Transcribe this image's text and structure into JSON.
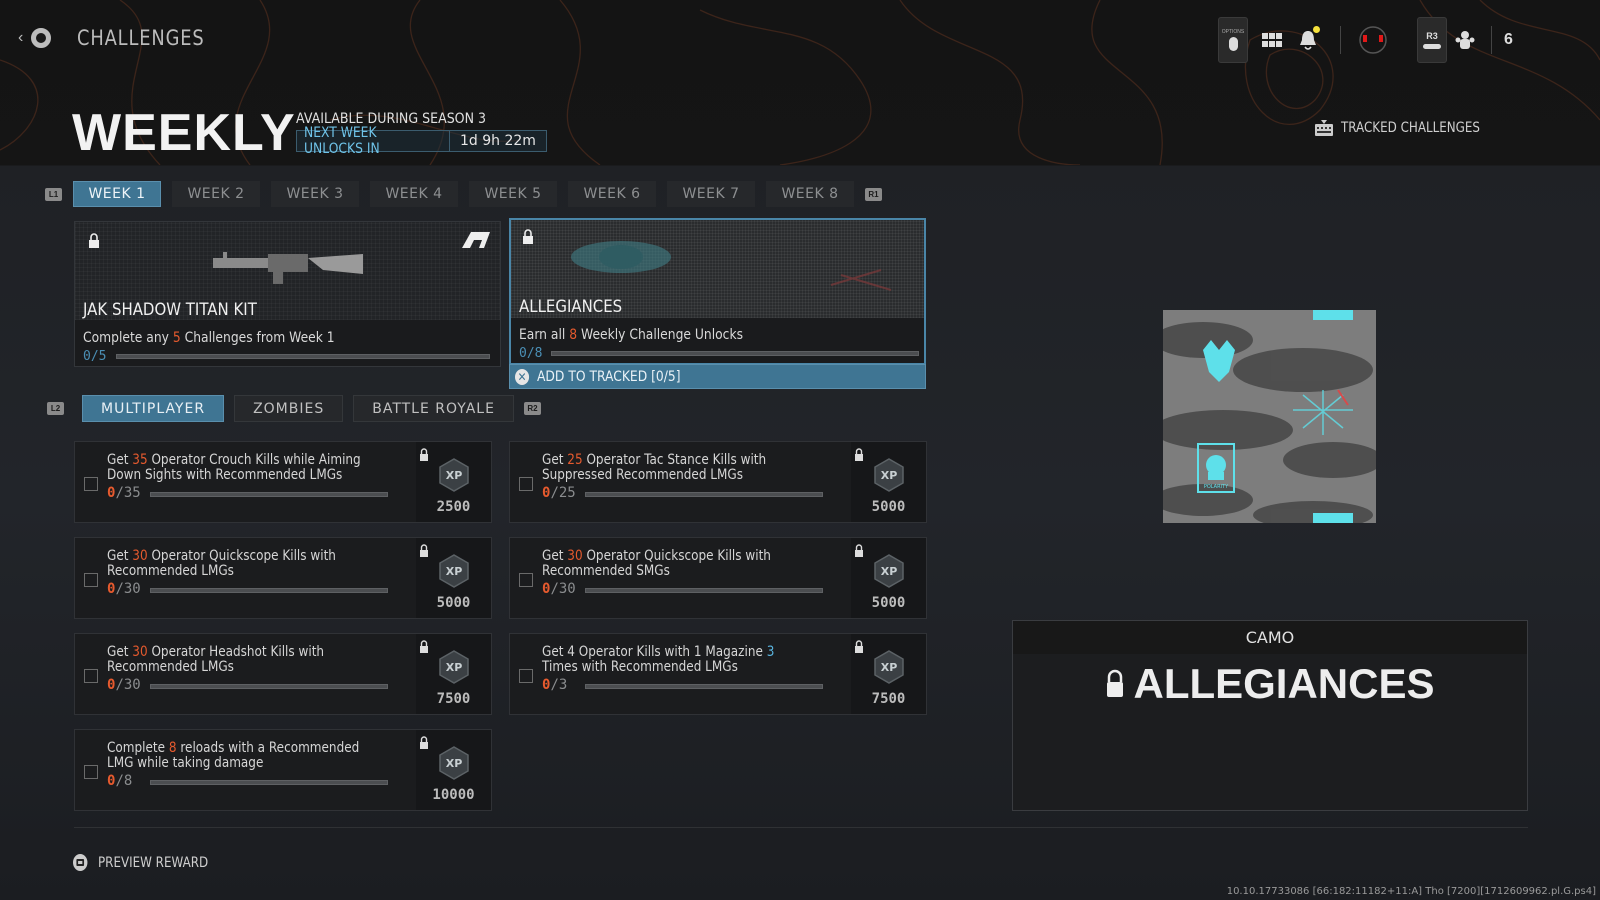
{
  "header": {
    "breadcrumb": "CHALLENGES",
    "title": "WEEKLY",
    "availability": "AVAILABLE DURING SEASON 3",
    "next_unlock_label": "NEXT WEEK UNLOCKS IN",
    "next_unlock_time": "1d 9h 22m",
    "tracked_label": "TRACKED CHALLENGES",
    "options_label": "OPTIONS",
    "r3_label": "R3",
    "party_count": "6",
    "notification_dot_color": "#f5e13c"
  },
  "week_tabs": {
    "left_trigger": "L1",
    "right_trigger": "R1",
    "items": [
      "WEEK 1",
      "WEEK 2",
      "WEEK 3",
      "WEEK 4",
      "WEEK 5",
      "WEEK 6",
      "WEEK 7",
      "WEEK 8"
    ],
    "active_index": 0
  },
  "rewards": [
    {
      "title": "JAK SHADOW TITAN KIT",
      "desc_pre": "Complete any ",
      "desc_num": "5",
      "desc_post": " Challenges from Week 1",
      "progress": "0/5",
      "progress_fraction": 0
    },
    {
      "title": "ALLEGIANCES",
      "desc_pre": "Earn all ",
      "desc_num": "8",
      "desc_post": " Weekly Challenge Unlocks",
      "progress": "0/8",
      "progress_fraction": 0
    }
  ],
  "add_tracked": "ADD TO TRACKED [0/5]",
  "mode_tabs": {
    "left_trigger": "L2",
    "right_trigger": "R2",
    "items": [
      "MULTIPLAYER",
      "ZOMBIES",
      "BATTLE ROYALE"
    ],
    "active_index": 0
  },
  "challenges": [
    {
      "pre": "Get ",
      "num": "35",
      "post": " Operator Crouch Kills while Aiming Down Sights with Recommended LMGs",
      "done": "0",
      "total": "/35",
      "xp": "2500",
      "progress_fraction": 0
    },
    {
      "pre": "Get ",
      "num": "25",
      "post": " Operator Tac Stance Kills with Suppressed Recommended LMGs",
      "done": "0",
      "total": "/25",
      "xp": "5000",
      "progress_fraction": 0
    },
    {
      "pre": "Get ",
      "num": "30",
      "post": " Operator Quickscope Kills with Recommended LMGs",
      "done": "0",
      "total": "/30",
      "xp": "5000",
      "progress_fraction": 0
    },
    {
      "pre": "Get ",
      "num": "30",
      "post": " Operator Quickscope Kills with Recommended SMGs",
      "done": "0",
      "total": "/30",
      "xp": "5000",
      "progress_fraction": 0
    },
    {
      "pre": "Get ",
      "num": "30",
      "post": " Operator Headshot Kills with Recommended LMGs",
      "done": "0",
      "total": "/30",
      "xp": "7500",
      "progress_fraction": 0
    },
    {
      "pre": "Get 4 Operator Kills with 1 Magazine ",
      "num": "3",
      "post": " Times with Recommended LMGs",
      "done": "0",
      "total": "/3",
      "xp": "7500",
      "progress_fraction": 0,
      "num_color": "blue"
    },
    {
      "pre": "Complete ",
      "num": "8",
      "post": " reloads with a Recommended LMG while taking damage",
      "done": "0",
      "total": "/8",
      "xp": "10000",
      "progress_fraction": 0
    }
  ],
  "reward_panel": {
    "category": "CAMO",
    "name": "ALLEGIANCES",
    "camo_badge_text": "POLARITY"
  },
  "footer": {
    "preview_label": "PREVIEW REWARD",
    "build_string": "10.10.17733086 [66:182:11182+11:A] Tho [7200][1712609962.pl.G.ps4]"
  },
  "colors": {
    "accent": "#3f7593",
    "highlight": "#e65a2e",
    "progress_text": "#4b8fb5",
    "cyan": "#5ee0ea"
  }
}
